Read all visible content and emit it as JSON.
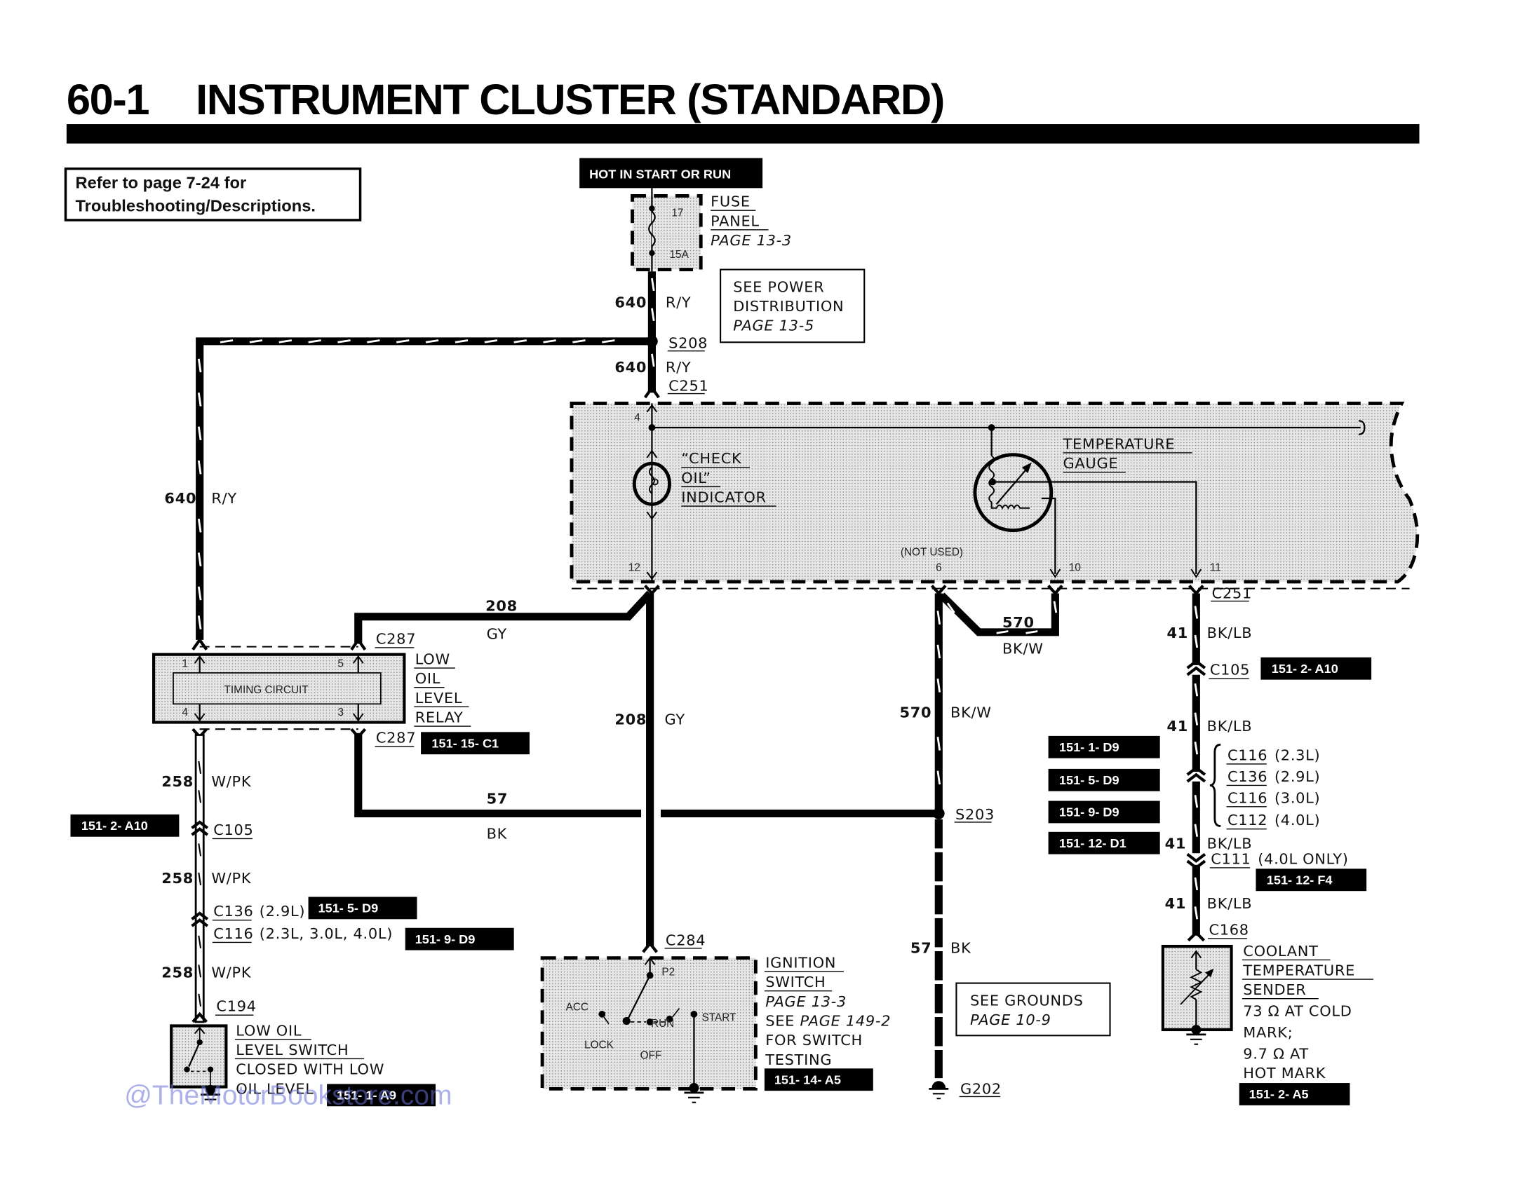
{
  "page": {
    "number": "60-1",
    "title": "INSTRUMENT CLUSTER (STANDARD)",
    "refer_note_line1": "Refer to page 7-24 for",
    "refer_note_line2": "Troubleshooting/Descriptions.",
    "watermark": "@TheMotorBookstore.com"
  },
  "power": {
    "hot_label": "HOT IN START OR RUN",
    "fuse_number": "17",
    "fuse_rating": "15A",
    "fuse_panel_line1": "FUSE",
    "fuse_panel_line2": "PANEL",
    "fuse_panel_page": "PAGE 13-3",
    "power_dist_line1": "SEE POWER",
    "power_dist_line2": "DISTRIBUTION",
    "power_dist_page": "PAGE 13-5"
  },
  "wires": {
    "w640_top": {
      "circuit": "640",
      "color": "R/Y"
    },
    "w640_mid": {
      "circuit": "640",
      "color": "R/Y"
    },
    "w640_left": {
      "circuit": "640",
      "color": "R/Y"
    },
    "w208_top": {
      "circuit": "208",
      "color": "GY"
    },
    "w208_vert": {
      "circuit": "208",
      "color": "GY"
    },
    "w57_horiz": {
      "circuit": "57",
      "color": "BK"
    },
    "w57_vert": {
      "circuit": "57",
      "color": "BK"
    },
    "w570_short": {
      "circuit": "570",
      "color": "BK/W"
    },
    "w570_vert": {
      "circuit": "570",
      "color": "BK/W"
    },
    "w258_a": {
      "circuit": "258",
      "color": "W/PK"
    },
    "w258_b": {
      "circuit": "258",
      "color": "W/PK"
    },
    "w258_c": {
      "circuit": "258",
      "color": "W/PK"
    },
    "w41_a": {
      "circuit": "41",
      "color": "BK/LB"
    },
    "w41_b": {
      "circuit": "41",
      "color": "BK/LB"
    },
    "w41_c": {
      "circuit": "41",
      "color": "BK/LB"
    },
    "w41_d": {
      "circuit": "41",
      "color": "BK/LB"
    }
  },
  "splices": {
    "s208": "S208",
    "s203": "S203",
    "g202": "G202"
  },
  "connectors": {
    "c251_top": "C251",
    "c251_bottom": "C251",
    "c287_top": "C287",
    "c287_bottom": "C287",
    "c105_left": "C105",
    "c136_left": "C136",
    "c136_left_note": "(2.9L)",
    "c116_left": "C116",
    "c116_left_note": "(2.3L, 3.0L, 4.0L)",
    "c194": "C194",
    "c284": "C284",
    "c105_right": "C105",
    "c116_r1": "C116",
    "c116_r1_note": "(2.3L)",
    "c136_r": "C136",
    "c136_r_note": "(2.9L)",
    "c116_r2": "C116",
    "c116_r2_note": "(3.0L)",
    "c112_r": "C112",
    "c112_r_note": "(4.0L)",
    "c111": "C111",
    "c111_note": "(4.0L ONLY)",
    "c168": "C168"
  },
  "cluster": {
    "check_oil_line1": "“CHECK",
    "check_oil_line2": "OIL”",
    "check_oil_line3": "INDICATOR",
    "temp_gauge_line1": "TEMPERATURE",
    "temp_gauge_line2": "GAUGE",
    "not_used": "(NOT USED)",
    "pins": {
      "p4": "4",
      "p12": "12",
      "p6": "6",
      "p10": "10",
      "p11": "11"
    }
  },
  "relay": {
    "name_line1": "LOW",
    "name_line2": "OIL",
    "name_line3": "LEVEL",
    "name_line4": "RELAY",
    "inner": "TIMING CIRCUIT",
    "pins": {
      "p1": "1",
      "p5": "5",
      "p4": "4",
      "p3": "3"
    }
  },
  "ignition": {
    "name_line1": "IGNITION",
    "name_line2": "SWITCH",
    "page": "PAGE 13-3",
    "see_line1_a": "SEE ",
    "see_line1_b": "PAGE 149-2",
    "see_line2": "FOR SWITCH",
    "see_line3": "TESTING",
    "positions": {
      "p2": "P2",
      "acc": "ACC",
      "lock": "LOCK",
      "off": "OFF",
      "run": "RUN",
      "start": "START"
    }
  },
  "low_oil_switch": {
    "line1": "LOW OIL",
    "line2": "LEVEL SWITCH",
    "line3": "CLOSED WITH LOW",
    "line4": "OIL LEVEL"
  },
  "grounds_note": {
    "line1": "SEE GROUNDS",
    "page": "PAGE 10-9"
  },
  "sender": {
    "line1": "COOLANT",
    "line2": "TEMPERATURE",
    "line3": "SENDER",
    "spec1": "73 Ω AT COLD",
    "spec2": "MARK;",
    "spec3": "9.7 Ω AT",
    "spec4": "HOT MARK"
  },
  "location_tags": {
    "relay": "151-   15-   C1",
    "c105_left": "151-   2-   A10",
    "c136_left": "151-   5-    D9",
    "c116_left": "151-   9-    D9",
    "low_oil_switch": "151-   1-    A9",
    "ignition": "151-   14-   A5",
    "c105_right": "151-   2-   A10",
    "r1": "151-   1-    D9",
    "r2": "151-   5-    D9",
    "r3": "151-   9-    D9",
    "r4": "151-   12-   D1",
    "c111": "151-   12-   F4",
    "sender": "151-   2-    A5"
  }
}
